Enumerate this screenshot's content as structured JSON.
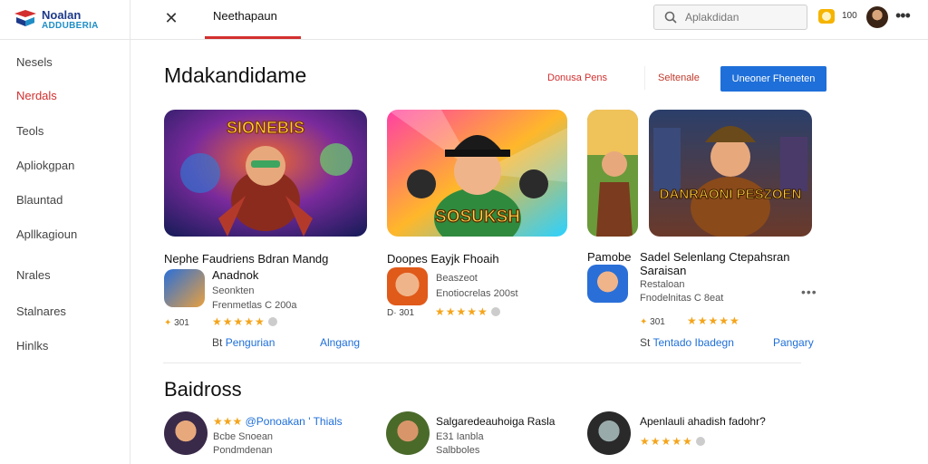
{
  "header": {
    "logo_line1": "Noalan",
    "logo_line2": "ADDUBERIA",
    "active_tab": "Neethapaun",
    "search_placeholder": "Aplakdidan",
    "coins": "100"
  },
  "sidebar": {
    "items": [
      {
        "label": "Nesels",
        "active": false
      },
      {
        "label": "Nerdals",
        "active": true
      },
      {
        "label": "Teols",
        "active": false
      },
      {
        "label": "Apliokgpan",
        "active": false
      },
      {
        "label": "Blauntad",
        "active": false
      },
      {
        "label": "Apllkagioun",
        "active": false
      },
      {
        "label": "Nrales",
        "active": false
      },
      {
        "label": "Stalnares",
        "active": false
      },
      {
        "label": "Hinlks",
        "active": false
      }
    ]
  },
  "featured": {
    "title": "Mdakandidame",
    "filter_a": "Donusa Pens",
    "filter_b": "Seltenale",
    "primary_button": "Uneoner Fheneten",
    "banner1_text": "SIONEBIS",
    "banner2_text": "SOSUKSH",
    "banner3_text": "DANRAONI PESZOEN",
    "cards": [
      {
        "title_line1": "Nephe Faudriens Bdran Mandg",
        "title_line2": "Anadnok",
        "sub1": "Seonkten",
        "sub2": "Frenmetlas C 200a",
        "count": "301",
        "stars": "★★★★★",
        "link_left": "Pengurian",
        "link_left_prefix": "Bt",
        "link_right": "Alngang"
      },
      {
        "title_line1": "Doopes Eayjk Fhoaih",
        "sub1": "Beaszeot",
        "sub2": "Enotiocrelas 200st",
        "count": "301",
        "count_prefix": "D·",
        "stars": "★★★★★"
      },
      {
        "title_prefix": "Pamobe",
        "title_line1": "Sadel Selenlang Ctepahsran",
        "title_line2": "Saraisan",
        "sub1": "Restaloan",
        "sub2": "Fnodelnitas C 8eat",
        "count": "301",
        "stars": "★★★★★",
        "link_left": "Tentado Ibadegn",
        "link_left_prefix": "St",
        "link_right": "Pangary"
      }
    ]
  },
  "recommended": {
    "title": "Baidross",
    "items": [
      {
        "stars": "★★★",
        "title": "@Ponoakan ' Thials",
        "sub1": "Bcbe Snoean",
        "sub2": "Pondmdenan"
      },
      {
        "title": "Salgaredeauhoiga Rasla",
        "sub1": "E31 Ianbla",
        "sub2": "Salbboles"
      },
      {
        "title": "Apenlauli ahadish fadohr?",
        "stars": "★★★★★"
      }
    ]
  },
  "colors": {
    "accent_red": "#d32f2f",
    "primary_blue": "#1e6fd9",
    "star": "#f4a51c"
  }
}
